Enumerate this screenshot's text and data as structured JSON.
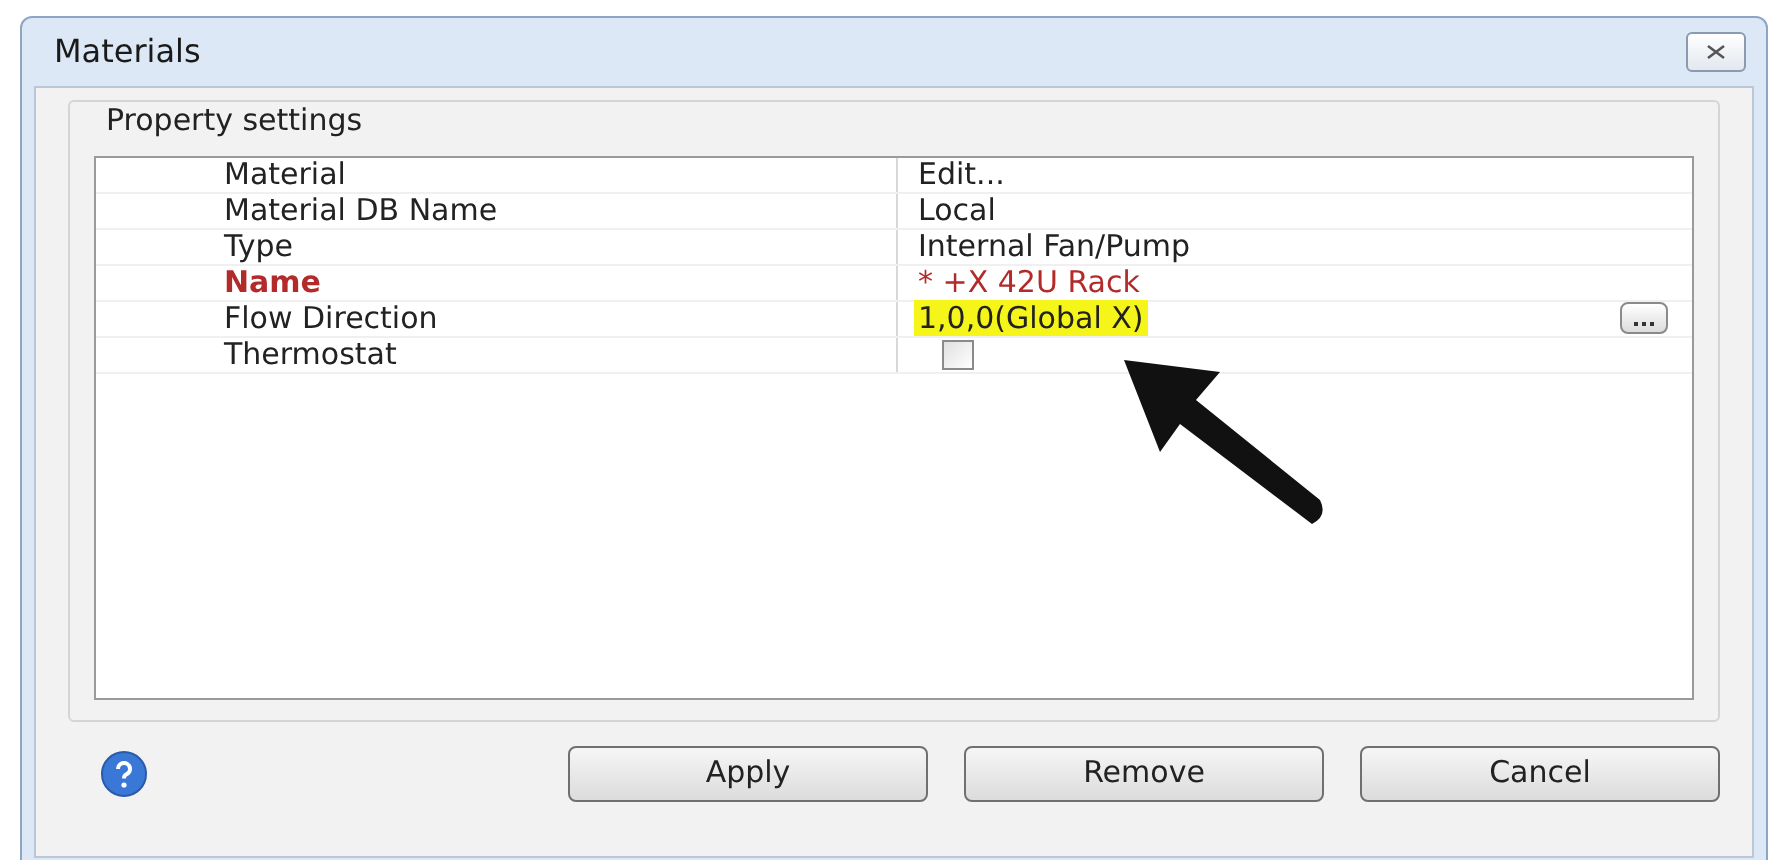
{
  "window": {
    "title": "Materials"
  },
  "group": {
    "title": "Property settings"
  },
  "properties": [
    {
      "kind": "text",
      "name": "Material",
      "value": "Edit...",
      "modified": false,
      "highlighted": false
    },
    {
      "kind": "text",
      "name": "Material DB Name",
      "value": "Local",
      "modified": false,
      "highlighted": false
    },
    {
      "kind": "text",
      "name": "Type",
      "value": "Internal Fan/Pump",
      "modified": false,
      "highlighted": false
    },
    {
      "kind": "text",
      "name": "Name",
      "value": "* +X 42U Rack",
      "modified": true,
      "highlighted": false
    },
    {
      "kind": "browse",
      "name": "Flow Direction",
      "value": "1,0,0(Global X)",
      "modified": false,
      "highlighted": true
    },
    {
      "kind": "checkbox",
      "name": "Thermostat",
      "checked": false,
      "modified": false
    }
  ],
  "buttons": [
    "Apply",
    "Remove",
    "Cancel"
  ]
}
